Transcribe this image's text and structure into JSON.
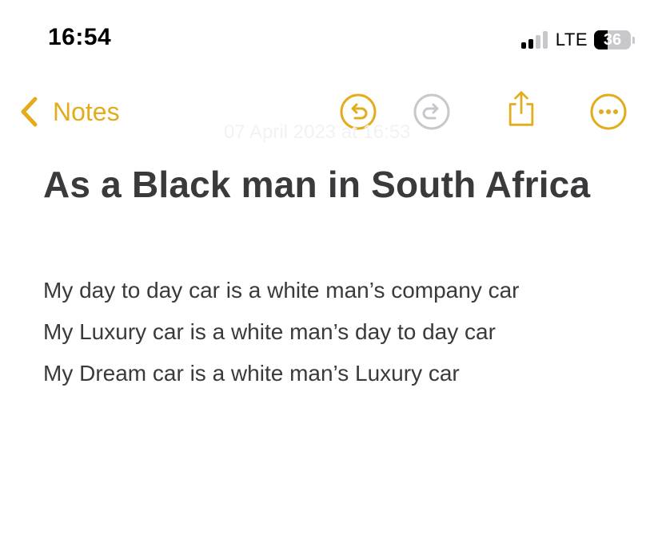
{
  "status_bar": {
    "time": "16:54",
    "network": "LTE",
    "battery_percent": "36",
    "battery_level": 0.36,
    "signal_bars_active": 2,
    "signal_bars_total": 4
  },
  "nav": {
    "back_label": "Notes",
    "back_icon": "chevron-left-icon",
    "undo_icon": "undo-icon",
    "redo_icon": "redo-icon",
    "share_icon": "share-icon",
    "more_icon": "ellipsis-circle-icon",
    "accent_color": "#e2ac1c",
    "disabled_color": "#c7c7cc"
  },
  "note": {
    "date_text": "07 April 2023 at 16:53",
    "title": "As a Black man in South Africa",
    "lines": [
      "My day to day car is a white man’s company car",
      "My Luxury car is a white man’s day to day car",
      "My Dream car is a white man’s Luxury car"
    ]
  }
}
